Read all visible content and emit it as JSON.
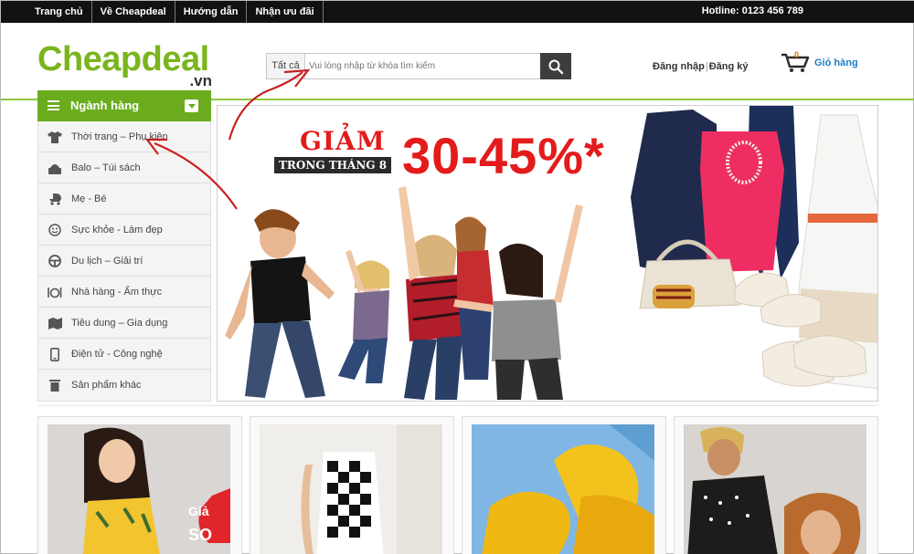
{
  "topnav": {
    "items": [
      "Trang chủ",
      "Về Cheapdeal",
      "Hướng dẫn",
      "Nhận ưu đãi"
    ],
    "hotline": "Hotline: 0123 456 789"
  },
  "header": {
    "logo_main": "Cheapdeal",
    "logo_suffix": ".vn",
    "search": {
      "category": "Tất cả",
      "placeholder": "Vui lòng nhập từ khóa tìm kiếm"
    },
    "login": "Đăng nhập",
    "register": "Đăng ký",
    "cart_count": "0",
    "cart_label": "Giỏ hàng"
  },
  "sidebar": {
    "title": "Ngành hàng",
    "items": [
      {
        "label": "Thời trang – Phụ kiện",
        "icon": "shirt-icon"
      },
      {
        "label": "Balo – Túi sách",
        "icon": "bag-icon"
      },
      {
        "label": "Mẹ - Bé",
        "icon": "stroller-icon"
      },
      {
        "label": "Sực khỏe - Làm đẹp",
        "icon": "smiley-icon"
      },
      {
        "label": "Du lịch – Giải trí",
        "icon": "steering-wheel-icon"
      },
      {
        "label": "Nhà hàng - Ẩm thực",
        "icon": "restaurant-icon"
      },
      {
        "label": "Tiêu dung – Gia dụng",
        "icon": "map-icon"
      },
      {
        "label": "Điện tử - Công nghệ",
        "icon": "phone-icon"
      },
      {
        "label": "Sản phẩm khác",
        "icon": "trash-icon"
      }
    ]
  },
  "banner": {
    "headline": "GIẢM",
    "subline": "TRONG THÁNG 8",
    "percent": "30-45%*"
  },
  "cards": [
    {
      "badge_top": "Giả",
      "badge_bottom": "SO"
    }
  ],
  "colors": {
    "brand_green": "#6aac1e",
    "promo_red": "#e31b1b",
    "link_blue": "#1e7fc2",
    "topbar": "#111111"
  }
}
